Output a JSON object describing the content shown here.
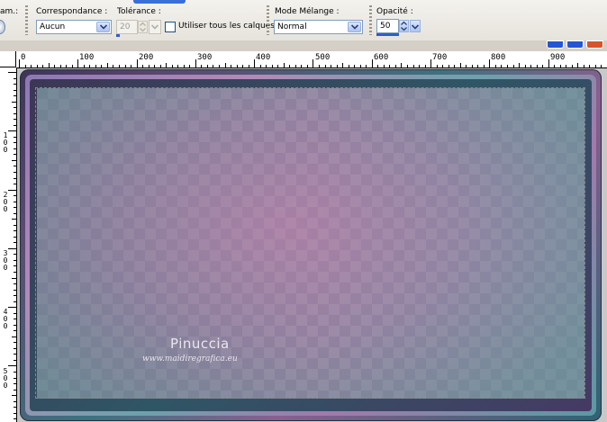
{
  "toolbar": {
    "partial_label": "am.:",
    "correspondance": {
      "label": "Correspondance :",
      "value": "Aucun"
    },
    "tolerance": {
      "label": "Tolérance :",
      "value": "20"
    },
    "all_layers": {
      "label": "Utiliser tous les calques",
      "checked": false
    },
    "blend_mode": {
      "label": "Mode Mélange :",
      "value": "Normal"
    },
    "opacity": {
      "label": "Opacité :",
      "value": "50"
    }
  },
  "rulers": {
    "horizontal": [
      "0",
      "100",
      "200",
      "300",
      "400",
      "500",
      "600",
      "700",
      "800",
      "900"
    ],
    "vertical": [
      "1|0|0",
      "2|0|0",
      "3|0|0",
      "4|0|0",
      "5|0|0"
    ]
  },
  "watermark": {
    "name": "Pinuccia",
    "site": "www.maidiregrafica.eu"
  },
  "colors": {
    "accent": "#2c5fc7",
    "field_border": "#7f9db9",
    "close_button": "#d8532a"
  }
}
